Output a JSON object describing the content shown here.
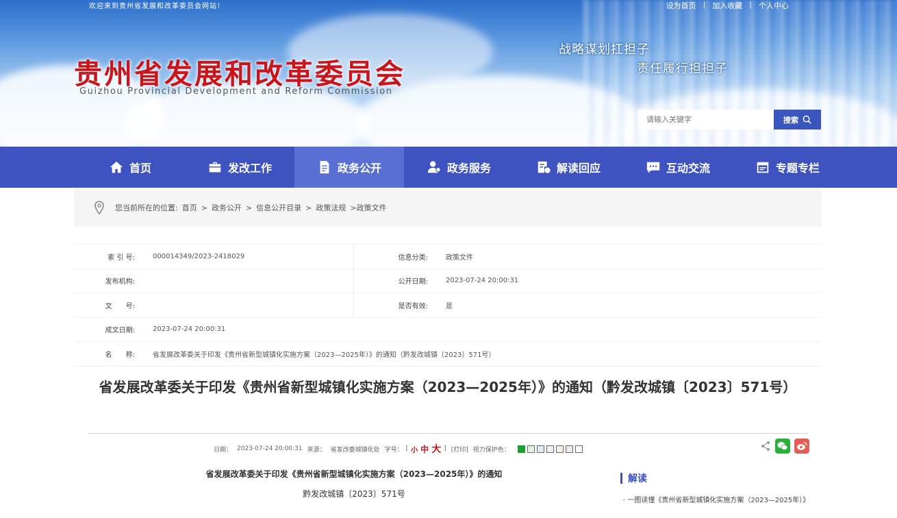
{
  "header": {
    "welcome": "欢迎来到贵州省发展和改革委员会网站！",
    "top_links": [
      "设为首页",
      "加入收藏",
      "个人中心"
    ],
    "top_link_sep": "|",
    "title": "贵州省发展和改革委员会",
    "subtitle": "Guizhou Provincial Development and Reform Commission",
    "slogan_line1": "战略谋划扛担子",
    "slogan_line2": "责任履行担担子",
    "search": {
      "placeholder": "请输入关键字",
      "button_label": "搜索"
    }
  },
  "nav": {
    "items": [
      {
        "label": "首页",
        "icon": "home-icon"
      },
      {
        "label": "发改工作",
        "icon": "briefcase-icon"
      },
      {
        "label": "政务公开",
        "icon": "document-icon",
        "active": true
      },
      {
        "label": "政务服务",
        "icon": "user-service-icon"
      },
      {
        "label": "解读回应",
        "icon": "chart-doc-icon"
      },
      {
        "label": "互动交流",
        "icon": "chat-icon"
      },
      {
        "label": "专题专栏",
        "icon": "calendar-icon"
      }
    ]
  },
  "breadcrumb": {
    "prefix": "您当前所在的位置:",
    "items": [
      "首页",
      "政务公开",
      "信息公开目录",
      "政策法规"
    ],
    "sep": ">",
    "last": ">政策文件"
  },
  "meta": {
    "index_label": "索 引 号:",
    "index_value": "000014349/2023-2418029",
    "category_label": "信息分类:",
    "category_value": "政策文件",
    "publisher_label": "发布机构:",
    "publisher_value": "",
    "open_date_label": "公开日期:",
    "open_date_value": "2023-07-24 20:00:31",
    "doc_no_label": "文　　号:",
    "doc_no_value": "",
    "valid_label": "是否有效:",
    "valid_value": "是",
    "written_date_label": "成文日期:",
    "written_date_value": "2023-07-24 20:00:31",
    "name_label": "名　　称:",
    "name_value": "省发展改革委关于印发《贵州省新型城镇化实施方案（2023—2025年）》的通知（黔发改城镇〔2023〕571号）"
  },
  "article": {
    "title": "省发展改革委关于印发《贵州省新型城镇化实施方案（2023—2025年）》的通知（黔发改城镇〔2023〕571号）",
    "info": {
      "date_label": "日期：",
      "date_value": "2023-07-24 20:00:31",
      "source_label": "来源：",
      "source_value": "省发改委城镇化处",
      "font_label": "字号：",
      "font_open": "[",
      "font_small": "小",
      "font_medium": "中",
      "font_large": "大",
      "font_close": "]",
      "print_label": "[打印]",
      "care_label": "视力保护色："
    },
    "doc_title": "省发展改革委关于印发《贵州省新型城镇化实施方案（2023—2025年）》的通知",
    "doc_number": "黔发改城镇〔2023〕571号"
  },
  "sidebar": {
    "heading": "解读",
    "link": "· 一图读懂《贵州省新型城镇化实施方案（2023—2025年）》"
  },
  "colors": {
    "nav_bg": "#3e52c0",
    "nav_active": "#5a6fd3",
    "title_red": "#c8161d",
    "wechat_green": "#2bb13b",
    "weibo_red": "#e25d53"
  }
}
